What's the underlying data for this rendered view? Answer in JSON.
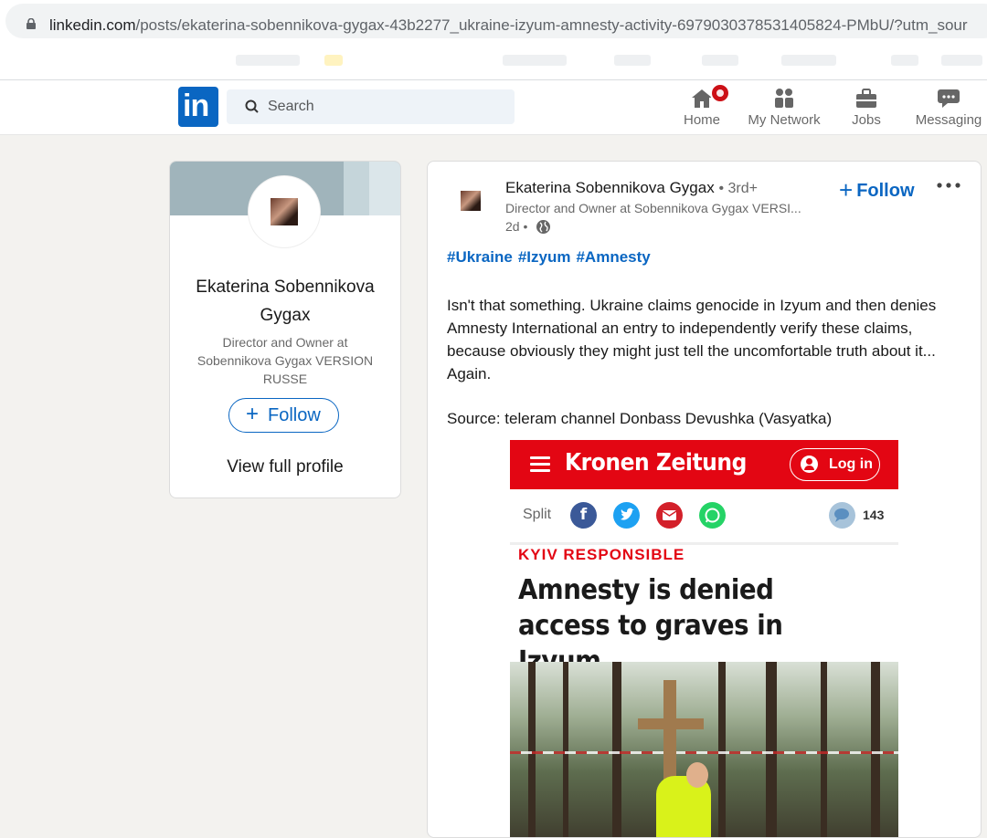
{
  "browser": {
    "url_host": "linkedin.com",
    "url_path": "/posts/ekaterina-sobennikova-gygax-43b2277_ukraine-izyum-amnesty-activity-6979030378531405824-PMbU/?utm_sour"
  },
  "nav": {
    "search_placeholder": "Search",
    "items": [
      {
        "label": "Home",
        "icon": "home-icon"
      },
      {
        "label": "My Network",
        "icon": "network-icon"
      },
      {
        "label": "Jobs",
        "icon": "briefcase-icon"
      },
      {
        "label": "Messaging",
        "icon": "messaging-icon"
      }
    ]
  },
  "profile": {
    "name": "Ekaterina Sobennikova Gygax",
    "headline": "Director and Owner at Sobennikova Gygax VERSION RUSSE",
    "follow_label": "Follow",
    "view_profile_label": "View full profile"
  },
  "post": {
    "author": "Ekaterina Sobennikova Gygax",
    "degree": "• 3rd+",
    "subtitle": "Director and Owner at Sobennikova Gygax VERSI...",
    "time": "2d •",
    "follow_label": "Follow",
    "hashtags": [
      "#Ukraine",
      "#Izyum",
      "#Amnesty"
    ],
    "body": "Isn't that something. Ukraine claims genocide in Izyum and then denies Amnesty International an entry to independently verify these claims, because obviously they might just tell the uncomfortable truth about it... Again.",
    "source": "Source: teleram channel Donbass Devushka (Vasyatka)"
  },
  "article": {
    "brand": "Kronen Zeitung",
    "login_label": "Log in",
    "share_label": "Split",
    "comment_count": "143",
    "kicker": "KYIV RESPONSIBLE",
    "headline": "Amnesty is denied access to graves in Izyum"
  },
  "colors": {
    "linkedin_blue": "#0a66c2",
    "krone_red": "#e30613",
    "page_bg": "#f3f2ef"
  }
}
